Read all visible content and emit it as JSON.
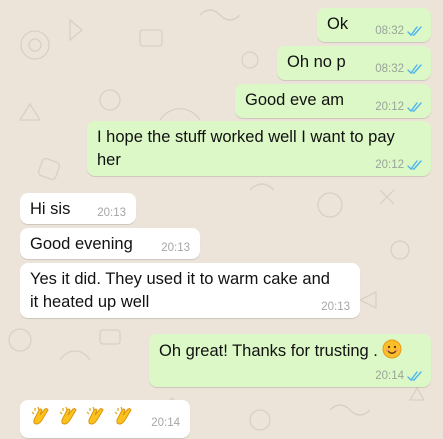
{
  "colors": {
    "background": "#ece4d9",
    "outgoing_bubble": "#dcf8c6",
    "incoming_bubble": "#ffffff",
    "read_receipt": "#4fb6ec",
    "timestamp": "#9aa39a"
  },
  "messages": [
    {
      "direction": "outgoing",
      "text": "Ok",
      "time": "08:32",
      "status": "read",
      "icon": "double-check-icon"
    },
    {
      "direction": "outgoing",
      "text": "Oh no p",
      "time": "08:32",
      "status": "read",
      "icon": "double-check-icon"
    },
    {
      "direction": "outgoing",
      "text": "Good eve am",
      "time": "20:12",
      "status": "read",
      "icon": "double-check-icon"
    },
    {
      "direction": "outgoing",
      "text": "I hope the stuff worked well I want to pay her",
      "time": "20:12",
      "status": "read",
      "icon": "double-check-icon"
    },
    {
      "direction": "incoming",
      "text": "Hi sis",
      "time": "20:13"
    },
    {
      "direction": "incoming",
      "text": "Good evening",
      "time": "20:13"
    },
    {
      "direction": "incoming",
      "text": "Yes it did. They used it to warm cake and it heated up well",
      "time": "20:13"
    },
    {
      "direction": "outgoing",
      "text": "Oh great! Thanks for trusting .",
      "emoji": "smiling-face-emoji",
      "time": "20:14",
      "status": "read",
      "icon": "double-check-icon"
    },
    {
      "direction": "incoming",
      "text": "",
      "emoji": "clapping-hands-emoji",
      "emoji_count": 4,
      "time": "20:14"
    }
  ]
}
